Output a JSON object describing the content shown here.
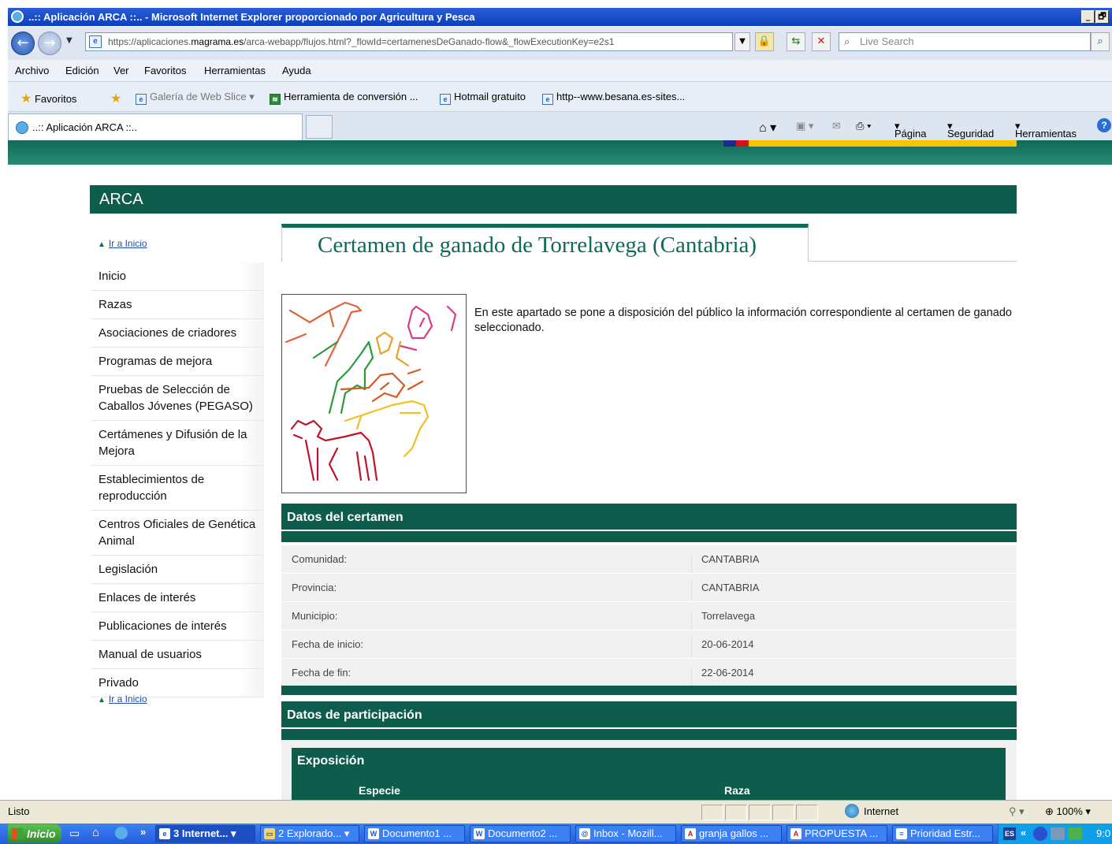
{
  "window": {
    "title": "..:: Aplicación ARCA ::.. - Microsoft Internet Explorer proporcionado por Agricultura y Pesca",
    "minimize_glyph": "_",
    "restore_glyph": "🗗"
  },
  "address_bar": {
    "url_prefix": "https://aplicaciones.",
    "url_domain": "magrama.es",
    "url_rest": "/arca-webapp/flujos.html?_flowId=certamenesDeGanado-flow&_flowExecutionKey=e2s1",
    "search_placeholder": "Live Search"
  },
  "menu": [
    "Archivo",
    "Edición",
    "Ver",
    "Favoritos",
    "Herramientas",
    "Ayuda"
  ],
  "favorites_bar": {
    "favorites_label": "Favoritos",
    "items": [
      "Galería de Web Slice",
      "Herramienta de conversión ...",
      "Hotmail gratuito",
      "http--www.besana.es-sites..."
    ]
  },
  "tab": {
    "label": "..:: Aplicación ARCA ::..",
    "tools": [
      "Página",
      "Seguridad",
      "Herramientas"
    ]
  },
  "site": {
    "brand": "ARCA",
    "ir_inicio": "Ir a Inicio",
    "menu": [
      "Inicio",
      "Razas",
      "Asociaciones de criadores",
      "Programas de mejora",
      "Pruebas de Selección de Caballos Jóvenes (PEGASO)",
      "Certámenes y Difusión de la Mejora",
      "Establecimientos de reproducción",
      "Centros Oficiales de Genética Animal",
      "Legislación",
      "Enlaces de interés",
      "Publicaciones de interés",
      "Manual de usuarios",
      "Privado"
    ],
    "page_title": "Certamen de ganado de Torrelavega (Cantabria)",
    "intro": "En este apartado se pone a disposición del público la información correspondiente al certamen de ganado seleccionado.",
    "datos_certamen": {
      "heading": "Datos del certamen",
      "rows": [
        {
          "label": "Comunidad:",
          "value": "CANTABRIA"
        },
        {
          "label": "Provincia:",
          "value": "CANTABRIA"
        },
        {
          "label": "Municipio:",
          "value": "Torrelavega"
        },
        {
          "label": "Fecha de inicio:",
          "value": "20-06-2014"
        },
        {
          "label": "Fecha de fin:",
          "value": "22-06-2014"
        }
      ]
    },
    "datos_participacion": {
      "heading": "Datos de participación",
      "exposicion": {
        "heading": "Exposición",
        "columns": [
          "Especie",
          "Raza"
        ]
      }
    }
  },
  "status_bar": {
    "text": "Listo",
    "zone": "Internet",
    "zoom": "100%"
  },
  "taskbar": {
    "start": "Inicio",
    "tasks": [
      "3 Internet...",
      "2 Explorado...",
      "Documento1 ...",
      "Documento2 ...",
      "Inbox - Mozill...",
      "granja gallos ...",
      "PROPUESTA ...",
      "Prioridad Estr..."
    ],
    "tray": {
      "lang": "ES",
      "clock": "9:0"
    }
  },
  "colors": {
    "brand_green": "#0e5c4c",
    "title_green": "#0e6b57",
    "xp_blue": "#245edb"
  }
}
